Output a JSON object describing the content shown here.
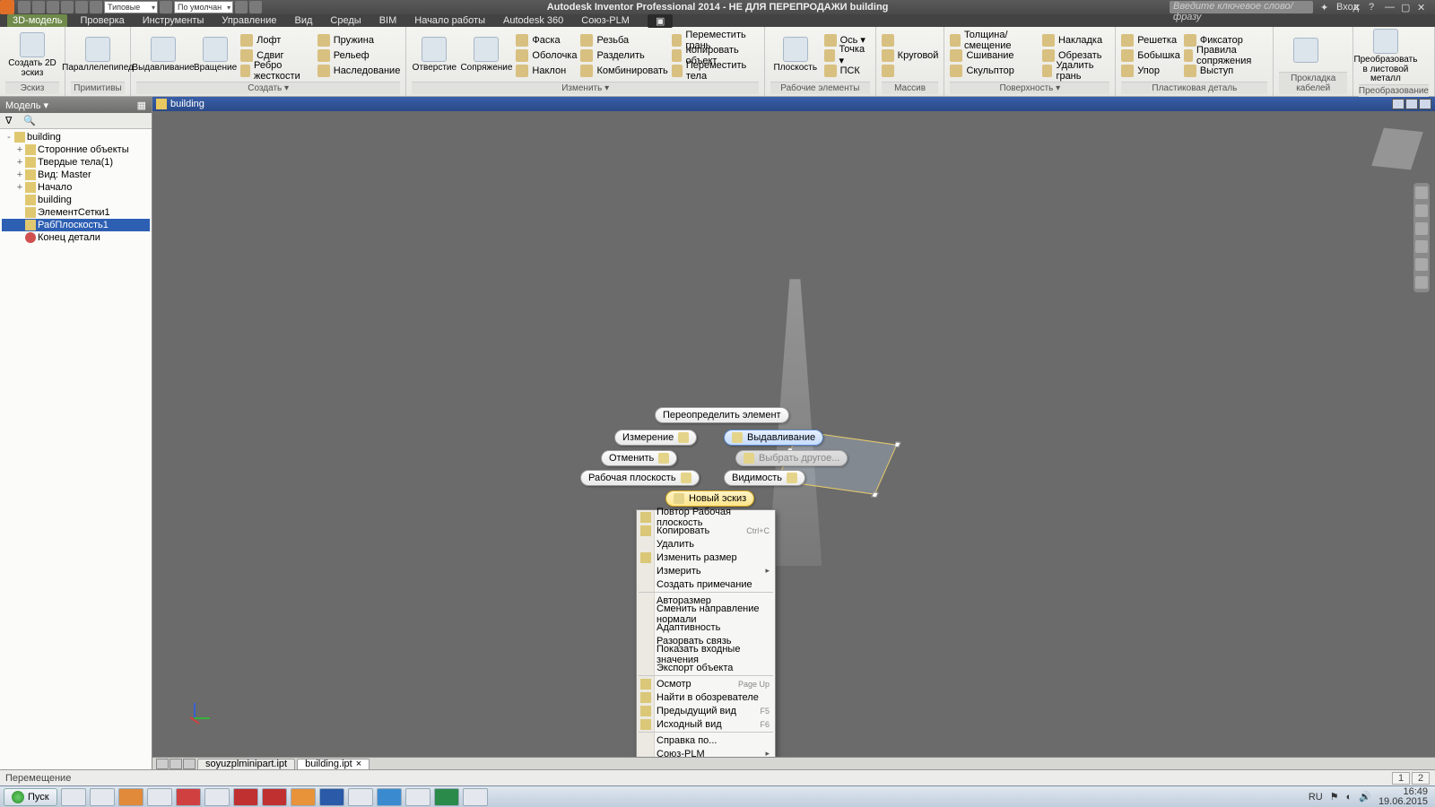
{
  "title": "Autodesk Inventor Professional 2014 - НЕ ДЛЯ ПЕРЕПРОДАЖИ   building",
  "search_placeholder": "Введите ключевое слово/фразу",
  "login": "Вход",
  "qat": {
    "combo1": "Типовые",
    "combo2": "По умолчан"
  },
  "tabs": [
    "3D-модель",
    "Проверка",
    "Инструменты",
    "Управление",
    "Вид",
    "Среды",
    "BIM",
    "Начало работы",
    "Autodesk 360",
    "Союз-PLM"
  ],
  "ribbon": {
    "g0": {
      "name": "Эскиз",
      "big0": "Создать\n2D эскиз"
    },
    "g1": {
      "name": "Примитивы",
      "big0": "Параллелепипед"
    },
    "g2": {
      "name": "Создать ▾",
      "big0": "Выдавливание",
      "big1": "Вращение",
      "r0": "Лофт",
      "r1": "Сдвиг",
      "r2": "Ребро жесткости",
      "r3": "Пружина",
      "r4": "Рельеф",
      "r5": "Наследование"
    },
    "g3": {
      "name": "Изменить ▾",
      "big0": "Отверстие",
      "big1": "Сопряжение",
      "r0": "Фаска",
      "r1": "Оболочка",
      "r2": "Наклон",
      "r3": "Резьба",
      "r4": "Разделить",
      "r5": "Комбинировать",
      "r6": "Переместить грань",
      "r7": "Копировать объект",
      "r8": "Переместить тела"
    },
    "g4": {
      "name": "Рабочие элементы",
      "big0": "Плоскость",
      "r0": "Ось ▾",
      "r1": "Точка ▾",
      "r2": "ПСК"
    },
    "g5": {
      "name": "Массив",
      "r0": "Круговой",
      "r1": ""
    },
    "g6": {
      "name": "Поверхность ▾",
      "r0": "Толщина/смещение",
      "r1": "Сшивание",
      "r2": "Скульптор",
      "r3": "Накладка",
      "r4": "Обрезать",
      "r5": "Удалить грань"
    },
    "g7": {
      "name": "Пластиковая деталь",
      "r0": "Решетка",
      "r1": "Бобышка",
      "r2": "Упор",
      "r3": "Фиксатор",
      "r4": "Правила сопряжения",
      "r5": "Выступ"
    },
    "g8": {
      "name": "Прокладка кабелей"
    },
    "g9": {
      "name": "Преобразование",
      "big0": "Преобразовать в\nлистовой металл"
    }
  },
  "model_panel": "Модель ▾",
  "tree": {
    "root": "building",
    "n0": "Сторонние объекты",
    "n1": "Твердые тела(1)",
    "n2": "Вид: Master",
    "n3": "Начало",
    "n4": "building",
    "n5": "ЭлементСетки1",
    "n6": "РабПлоскость1",
    "n7": "Конец детали"
  },
  "vp_title": "building",
  "mm": {
    "redefine": "Переопределить элемент",
    "measure": "Измерение",
    "extrude": "Выдавливание",
    "cancel": "Отменить",
    "pick_other": "Выбрать другое...",
    "workplane": "Рабочая плоскость",
    "visibility": "Видимость",
    "newsketch": "Новый эскиз"
  },
  "ctx": {
    "repeat": "Повтор Рабочая плоскость",
    "copy": "Копировать",
    "copy_sc": "Ctrl+C",
    "delete": "Удалить",
    "resize": "Изменить размер",
    "measure": "Измерить",
    "note": "Создать примечание",
    "autodim": "Авторазмер",
    "flipnorm": "Сменить направление нормали",
    "adapt": "Адаптивность",
    "break": "Разорвать связь",
    "showin": "Показать входные значения",
    "export": "Экспорт объекта",
    "inspect": "Осмотр",
    "inspect_sc": "Page Up",
    "findbrowser": "Найти в обозревателе",
    "prevview": "Предыдущий вид",
    "prevview_sc": "F5",
    "homeview": "Исходный вид",
    "homeview_sc": "F6",
    "help": "Справка по...",
    "soyuz": "Союз-PLM"
  },
  "doc_tabs": {
    "t0": "soyuzplminipart.ipt",
    "t1": "building.ipt"
  },
  "status_msg": "Перемещение",
  "status_r1": "1",
  "status_r2": "2",
  "taskbar": {
    "start": "Пуск",
    "lang": "RU",
    "time": "16:49",
    "date": "19.06.2015"
  }
}
